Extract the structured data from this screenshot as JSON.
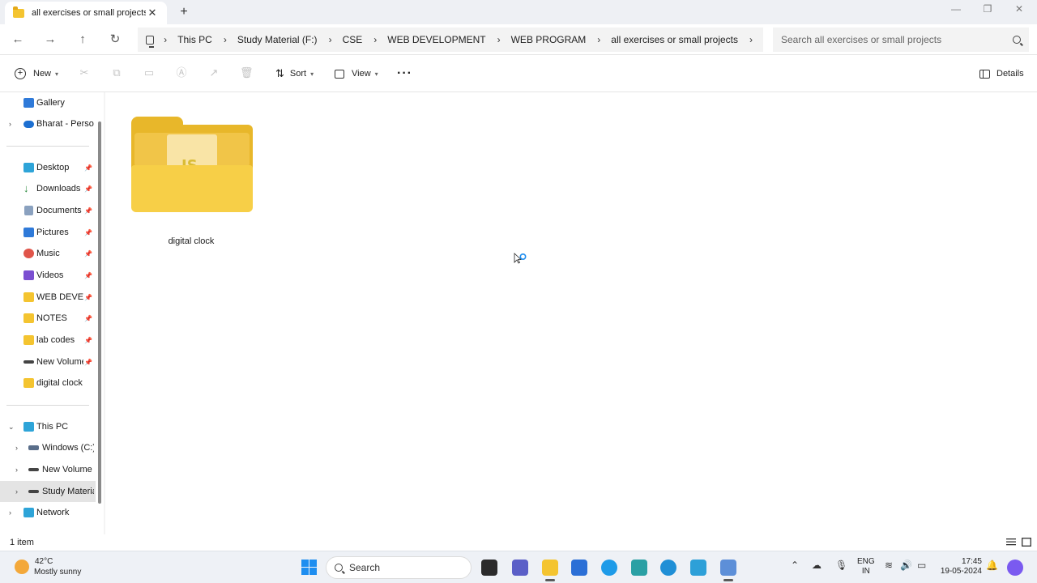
{
  "window": {
    "tab_title": "all exercises or small projects",
    "tab_close": "✕",
    "new_tab": "+",
    "minimize": "—",
    "maximize": "❐",
    "close": "✕"
  },
  "nav": {
    "back": "←",
    "forward": "→",
    "up": "↑",
    "refresh": "↻"
  },
  "breadcrumbs": [
    "This PC",
    "Study Material (F:)",
    "CSE",
    "WEB DEVELOPMENT",
    "WEB PROGRAM",
    "all exercises or small projects"
  ],
  "search": {
    "placeholder": "Search all exercises or small projects"
  },
  "commands": {
    "new": "New",
    "sort": "Sort",
    "view": "View",
    "more": "···",
    "details": "Details"
  },
  "sidebar": {
    "top": [
      {
        "label": "Gallery",
        "icon": "gallery-icon"
      },
      {
        "label": "Bharat - Personal",
        "icon": "cloud-icon"
      }
    ],
    "quick": [
      {
        "label": "Desktop",
        "icon": "desktop-icon"
      },
      {
        "label": "Downloads",
        "icon": "download-icon"
      },
      {
        "label": "Documents",
        "icon": "document-icon"
      },
      {
        "label": "Pictures",
        "icon": "pictures-icon"
      },
      {
        "label": "Music",
        "icon": "music-icon"
      },
      {
        "label": "Videos",
        "icon": "videos-icon"
      },
      {
        "label": "WEB DEVELOPMENT",
        "icon": "folder-icon"
      },
      {
        "label": "NOTES",
        "icon": "folder-icon"
      },
      {
        "label": "lab codes",
        "icon": "folder-icon"
      },
      {
        "label": "New Volume",
        "icon": "drive-icon"
      },
      {
        "label": "digital clock",
        "icon": "folder-icon"
      }
    ],
    "this_pc": "This PC",
    "drives": [
      {
        "label": "Windows (C:)"
      },
      {
        "label": "New Volume (E:)"
      },
      {
        "label": "Study Material (F:)"
      }
    ],
    "network": "Network"
  },
  "files": [
    {
      "name": "digital clock",
      "badge": "JS"
    }
  ],
  "status": {
    "item_count": "1 item"
  },
  "taskbar": {
    "temperature": "42°C",
    "weather": "Mostly sunny",
    "search_label": "Search",
    "lang_top": "ENG",
    "lang_bottom": "IN",
    "time": "17:45",
    "date": "19-05-2024"
  },
  "colors": {
    "folder_back": "#e8b72a",
    "folder_front": "#f7cf47",
    "selection": "#e4e4e4",
    "accent": "#1e8ef0"
  }
}
